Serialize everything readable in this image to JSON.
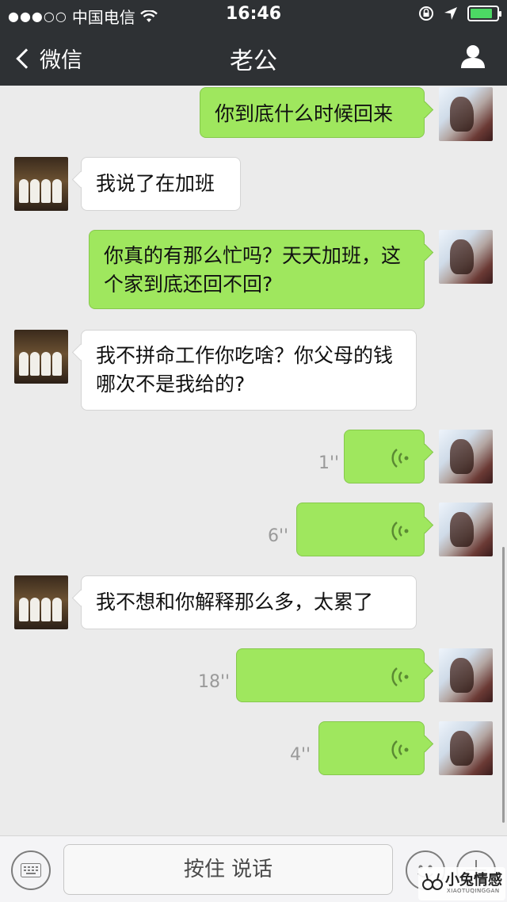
{
  "status_bar": {
    "signal_dots": "●●●○○",
    "carrier": "中国电信",
    "time": "16:46"
  },
  "nav": {
    "back_label": "微信",
    "title": "老公"
  },
  "messages": [
    {
      "sender": "me",
      "type": "text",
      "text": "你到底什么时候回来"
    },
    {
      "sender": "other",
      "type": "text",
      "text": "我说了在加班"
    },
    {
      "sender": "me",
      "type": "text",
      "text": "你真的有那么忙吗？天天加班，这个家到底还回不回?"
    },
    {
      "sender": "other",
      "type": "text",
      "text": "我不拼命工作你吃啥？你父母的钱哪次不是我给的?"
    },
    {
      "sender": "me",
      "type": "voice",
      "duration": "1''"
    },
    {
      "sender": "me",
      "type": "voice",
      "duration": "6''"
    },
    {
      "sender": "other",
      "type": "text",
      "text": "我不想和你解释那么多，太累了"
    },
    {
      "sender": "me",
      "type": "voice",
      "duration": "18''"
    },
    {
      "sender": "me",
      "type": "voice",
      "duration": "4''"
    }
  ],
  "input_bar": {
    "hold_to_talk_label": "按住 说话"
  },
  "watermark": {
    "name": "小兔情感",
    "subtitle": "XIAOTUQINGGAN"
  },
  "colors": {
    "nav_background": "#2e3134",
    "bubble_me": "#9fe75e",
    "bubble_other": "#ffffff",
    "chat_background": "#ebebeb"
  }
}
